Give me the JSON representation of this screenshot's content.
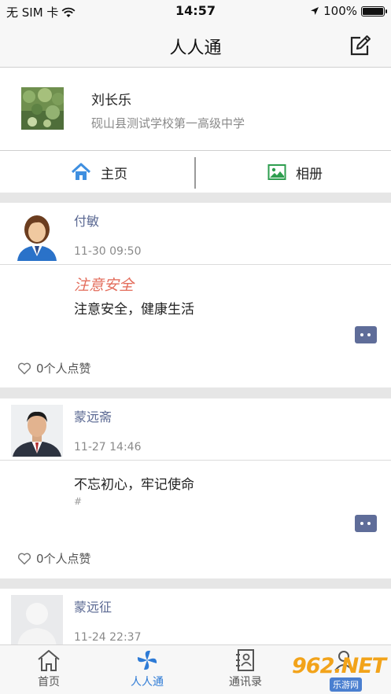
{
  "status": {
    "carrier": "无 SIM 卡",
    "time": "14:57",
    "battery": "100%",
    "battery_level": 1.0
  },
  "navbar": {
    "title": "人人通",
    "edit_icon": "compose-icon"
  },
  "profile": {
    "name": "刘长乐",
    "school": "砚山县测试学校第一高级中学"
  },
  "tabs": [
    {
      "label": "主页",
      "icon": "home-icon",
      "color": "#3f8fe0"
    },
    {
      "label": "相册",
      "icon": "image-icon",
      "color": "#2e9e4f"
    }
  ],
  "posts": [
    {
      "author": "付敏",
      "time": "11-30 09:50",
      "title": "注意安全",
      "content": "注意安全，健康生活",
      "likes": "0个人点赞"
    },
    {
      "author": "蒙远斋",
      "time": "11-27 14:46",
      "content": "不忘初心，牢记使命",
      "hashtag": "#",
      "likes": "0个人点赞"
    },
    {
      "author": "蒙远征",
      "time": "11-24 22:37"
    }
  ],
  "tabbar": [
    {
      "label": "首页",
      "icon": "home-outline-icon"
    },
    {
      "label": "人人通",
      "icon": "pinwheel-icon",
      "active": true
    },
    {
      "label": "通讯录",
      "icon": "contacts-icon"
    },
    {
      "label": "",
      "icon": "person-icon"
    }
  ],
  "watermark": {
    "number": "962.NET",
    "subtitle": "乐游网"
  },
  "colors": {
    "accent": "#2e7bd6",
    "name_link": "#5a6892",
    "title_red": "#e36d5c",
    "comment_btn": "#5f6d99"
  }
}
